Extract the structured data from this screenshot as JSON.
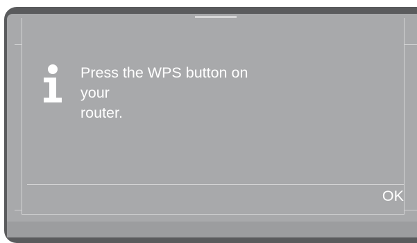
{
  "dialog": {
    "icon": "info-icon",
    "message_lines": [
      "Press the WPS button on",
      "your",
      "router."
    ],
    "ok_label": "OK"
  },
  "colors": {
    "frame": "#5a5b5d",
    "screen": "#a8a9ab",
    "text": "#ffffff",
    "lines": "#d3d3d4"
  }
}
